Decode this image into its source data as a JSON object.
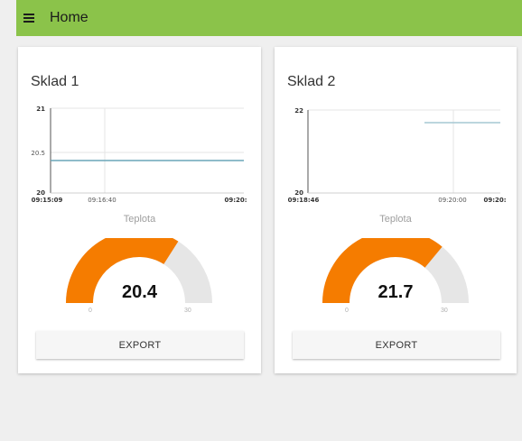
{
  "header": {
    "title": "Home",
    "menu_icon": "hamburger-menu-icon",
    "color": "#8bc34a"
  },
  "cards": [
    {
      "title": "Sklad 1",
      "chart_data": {
        "type": "line",
        "y_ticks": [
          "21",
          "20.5",
          "20"
        ],
        "ylim": [
          20,
          21
        ],
        "x_ticks": [
          "09:15:09",
          "09:16:40",
          "09:20:"
        ],
        "series": [
          {
            "values": [
              20.4,
              20.4
            ],
            "color": "#6aa6b8"
          }
        ]
      },
      "gauge": {
        "label": "Teplota",
        "value": "20.4",
        "min": "0",
        "max": "30",
        "fraction": 0.68,
        "color": "#f57c00"
      },
      "export_label": "EXPORT"
    },
    {
      "title": "Sklad 2",
      "chart_data": {
        "type": "line",
        "y_ticks": [
          "22",
          "20"
        ],
        "ylim": [
          20,
          22
        ],
        "x_ticks": [
          "09:18:46",
          "09:20:00",
          "09:20:"
        ],
        "series": [
          {
            "values": [
              21.7,
              21.7
            ],
            "color": "#a6c8d4"
          }
        ]
      },
      "gauge": {
        "label": "Teplota",
        "value": "21.7",
        "min": "0",
        "max": "30",
        "fraction": 0.72,
        "color": "#f57c00"
      },
      "export_label": "EXPORT"
    }
  ]
}
